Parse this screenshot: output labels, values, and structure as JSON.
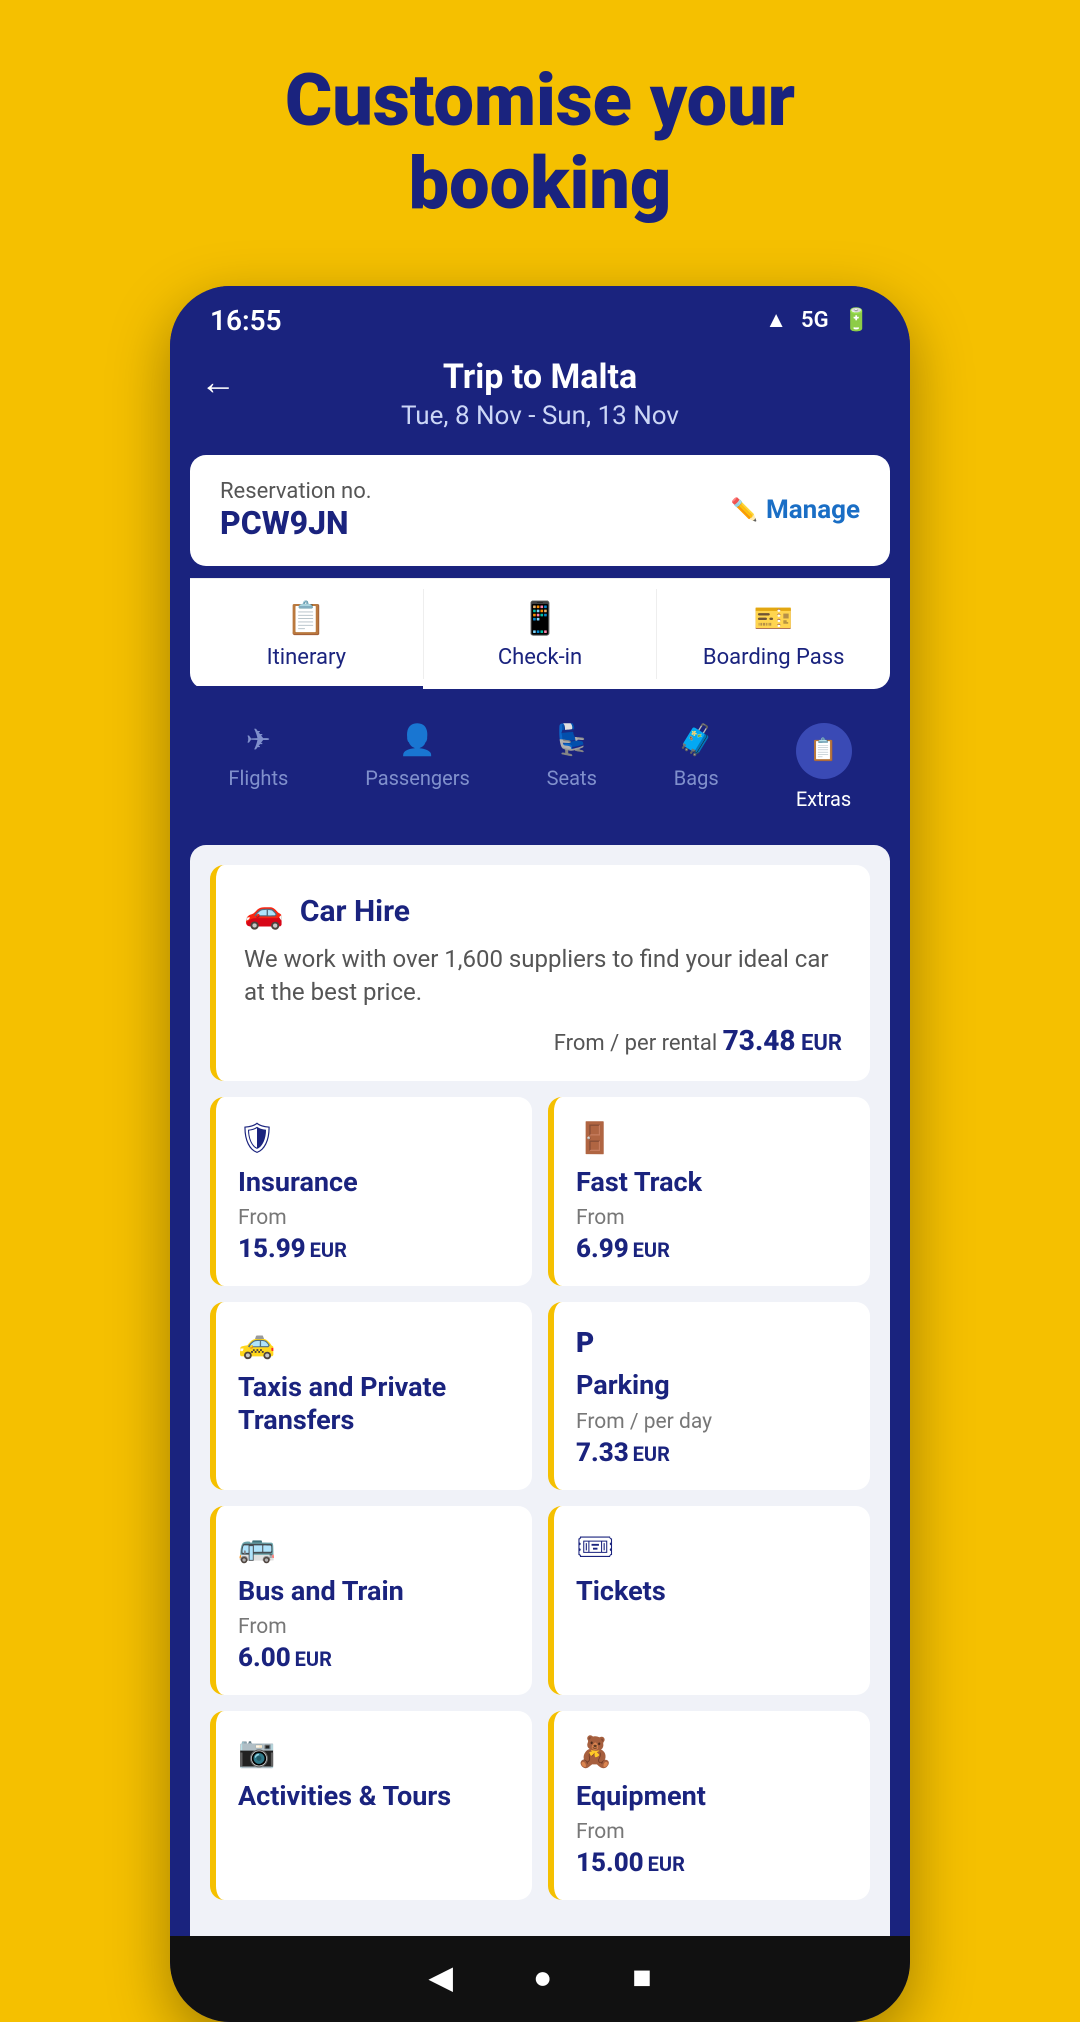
{
  "page": {
    "headline_line1": "Customise your",
    "headline_line2": "booking"
  },
  "status_bar": {
    "time": "16:55"
  },
  "header": {
    "back_label": "←",
    "title": "Trip to Malta",
    "dates": "Tue, 8 Nov - Sun, 13 Nov"
  },
  "reservation": {
    "label": "Reservation no.",
    "number": "PCW9JN",
    "manage_label": "Manage"
  },
  "tabs": [
    {
      "id": "itinerary",
      "label": "Itinerary",
      "icon": "📋",
      "active": false
    },
    {
      "id": "checkin",
      "label": "Check-in",
      "icon": "📱",
      "active": false
    },
    {
      "id": "boarding",
      "label": "Boarding Pass",
      "icon": "🎫",
      "active": false
    }
  ],
  "nav": {
    "items": [
      {
        "id": "flights",
        "label": "Flights",
        "icon": "✈",
        "active": false
      },
      {
        "id": "passengers",
        "label": "Passengers",
        "icon": "👤",
        "active": false
      },
      {
        "id": "seats",
        "label": "Seats",
        "icon": "💺",
        "active": false
      },
      {
        "id": "bags",
        "label": "Bags",
        "icon": "🧳",
        "active": false
      },
      {
        "id": "extras",
        "label": "Extras",
        "icon": "📋",
        "active": true
      }
    ]
  },
  "car_hire": {
    "title": "Car Hire",
    "icon": "🚗",
    "description": "We work with over 1,600 suppliers to find your ideal car at the best price.",
    "price_prefix": "From / per rental",
    "price": "73.48",
    "currency": "EUR"
  },
  "extra_cards": [
    {
      "id": "insurance",
      "title": "Insurance",
      "icon": "🛡",
      "from_label": "From",
      "price": "15.99",
      "currency": "EUR"
    },
    {
      "id": "fast-track",
      "title": "Fast Track",
      "icon": "🚪",
      "from_label": "From",
      "price": "6.99",
      "currency": "EUR"
    },
    {
      "id": "taxis",
      "title": "Taxis and Private Transfers",
      "icon": "🚕",
      "from_label": "",
      "price": "",
      "currency": ""
    },
    {
      "id": "parking",
      "title": "Parking",
      "icon": "🅿",
      "from_label": "From / per day",
      "price": "7.33",
      "currency": "EUR"
    },
    {
      "id": "bus-train",
      "title": "Bus and Train",
      "icon": "🚌",
      "from_label": "From",
      "price": "6.00",
      "currency": "EUR"
    },
    {
      "id": "tickets",
      "title": "Tickets",
      "icon": "🎫",
      "from_label": "",
      "price": "",
      "currency": ""
    },
    {
      "id": "activities",
      "title": "Activities & Tours",
      "icon": "📷",
      "from_label": "",
      "price": "",
      "currency": ""
    },
    {
      "id": "equipment",
      "title": "Equipment",
      "icon": "🧸",
      "from_label": "From",
      "price": "15.00",
      "currency": "EUR"
    }
  ],
  "home_bar": {
    "back": "◀",
    "home": "●",
    "square": "■"
  }
}
